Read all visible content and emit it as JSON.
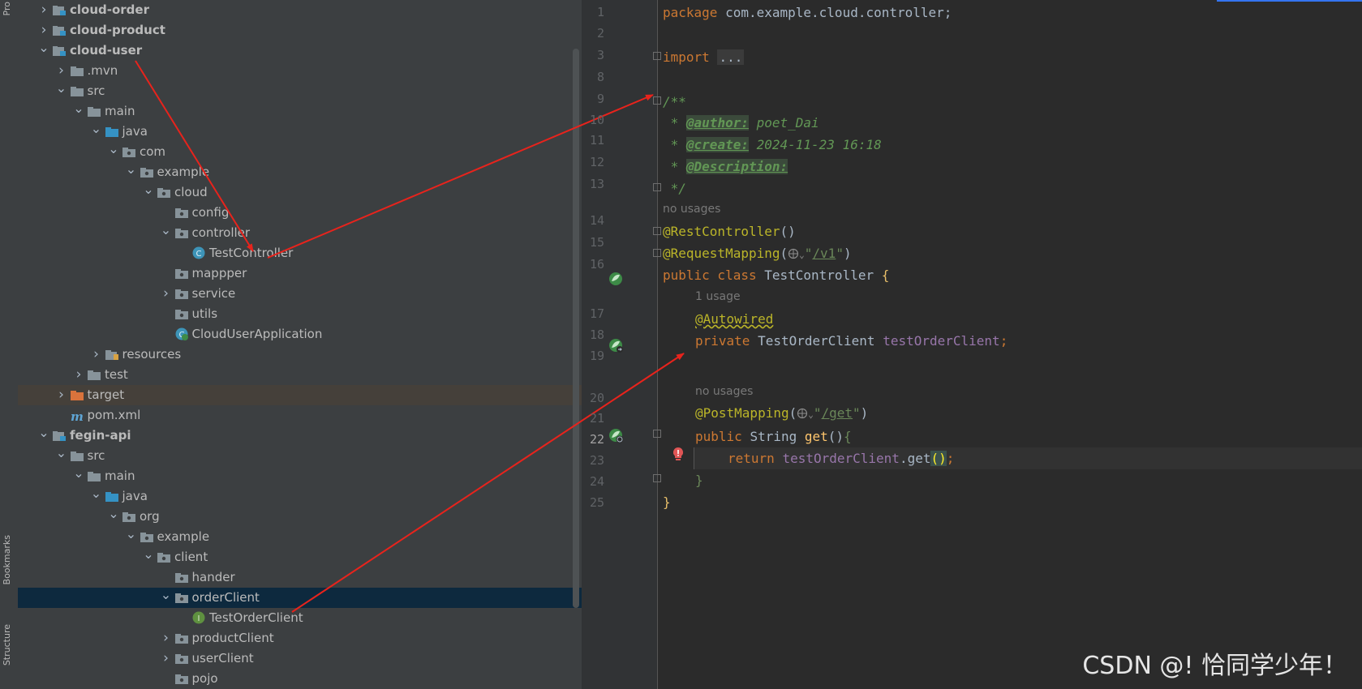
{
  "sidebar": {
    "tabs": [
      "Pro",
      "Bookmarks",
      "Structure"
    ]
  },
  "tree": [
    {
      "label": "cloud-order",
      "depth": 2,
      "arrow": "right",
      "icon": "module",
      "bold": true
    },
    {
      "label": "cloud-product",
      "depth": 2,
      "arrow": "right",
      "icon": "module",
      "bold": true
    },
    {
      "label": "cloud-user",
      "depth": 2,
      "arrow": "down",
      "icon": "module",
      "bold": true
    },
    {
      "label": ".mvn",
      "depth": 3,
      "arrow": "right",
      "icon": "folder"
    },
    {
      "label": "src",
      "depth": 3,
      "arrow": "down",
      "icon": "folder"
    },
    {
      "label": "main",
      "depth": 4,
      "arrow": "down",
      "icon": "folder"
    },
    {
      "label": "java",
      "depth": 5,
      "arrow": "down",
      "icon": "folder-blue"
    },
    {
      "label": "com",
      "depth": 6,
      "arrow": "down",
      "icon": "package"
    },
    {
      "label": "example",
      "depth": 7,
      "arrow": "down",
      "icon": "package"
    },
    {
      "label": "cloud",
      "depth": 8,
      "arrow": "down",
      "icon": "package"
    },
    {
      "label": "config",
      "depth": 9,
      "arrow": "none",
      "icon": "package"
    },
    {
      "label": "controller",
      "depth": 9,
      "arrow": "down",
      "icon": "package"
    },
    {
      "label": "TestController",
      "depth": 10,
      "arrow": "none",
      "icon": "class"
    },
    {
      "label": "mappper",
      "depth": 9,
      "arrow": "none",
      "icon": "package"
    },
    {
      "label": "service",
      "depth": 9,
      "arrow": "right",
      "icon": "package"
    },
    {
      "label": "utils",
      "depth": 9,
      "arrow": "none",
      "icon": "package"
    },
    {
      "label": "CloudUserApplication",
      "depth": 9,
      "arrow": "none",
      "icon": "spring-class"
    },
    {
      "label": "resources",
      "depth": 5,
      "arrow": "right",
      "icon": "resources"
    },
    {
      "label": "test",
      "depth": 4,
      "arrow": "right",
      "icon": "folder"
    },
    {
      "label": "target",
      "depth": 3,
      "arrow": "right",
      "icon": "folder-orange",
      "highlight": true
    },
    {
      "label": "pom.xml",
      "depth": 3,
      "arrow": "none",
      "icon": "maven"
    },
    {
      "label": "fegin-api",
      "depth": 2,
      "arrow": "down",
      "icon": "module",
      "bold": true
    },
    {
      "label": "src",
      "depth": 3,
      "arrow": "down",
      "icon": "folder"
    },
    {
      "label": "main",
      "depth": 4,
      "arrow": "down",
      "icon": "folder"
    },
    {
      "label": "java",
      "depth": 5,
      "arrow": "down",
      "icon": "folder-blue"
    },
    {
      "label": "org",
      "depth": 6,
      "arrow": "down",
      "icon": "package"
    },
    {
      "label": "example",
      "depth": 7,
      "arrow": "down",
      "icon": "package"
    },
    {
      "label": "client",
      "depth": 8,
      "arrow": "down",
      "icon": "package"
    },
    {
      "label": "hander",
      "depth": 9,
      "arrow": "none",
      "icon": "package"
    },
    {
      "label": "orderClient",
      "depth": 9,
      "arrow": "down",
      "icon": "package",
      "selected": true
    },
    {
      "label": "TestOrderClient",
      "depth": 10,
      "arrow": "none",
      "icon": "interface"
    },
    {
      "label": "productClient",
      "depth": 9,
      "arrow": "right",
      "icon": "package"
    },
    {
      "label": "userClient",
      "depth": 9,
      "arrow": "right",
      "icon": "package"
    },
    {
      "label": "pojo",
      "depth": 9,
      "arrow": "none",
      "icon": "package"
    }
  ],
  "editor": {
    "line_numbers": [
      "1",
      "2",
      "3",
      "8",
      "9",
      "10",
      "11",
      "12",
      "13",
      "14",
      "15",
      "16",
      "17",
      "18",
      "19",
      "20",
      "21",
      "22",
      "23",
      "24",
      "25"
    ],
    "current_line": "22",
    "code": {
      "l1_kw": "package",
      "l1_rest": " com.example.cloud.controller;",
      "l3_kw": "import",
      "l3_fold": "...",
      "l9": "/**",
      "l10_star": " * ",
      "l10_tag": "@author:",
      "l10_val": " poet_Dai",
      "l11_star": " * ",
      "l11_tag": "@create:",
      "l11_val": " 2024-11-23 16:18",
      "l12_star": " * ",
      "l12_tag": "@Description:",
      "l13": " */",
      "hint_no_usages_1": "no usages",
      "l14_ann": "@RestController",
      "l14_paren": "()",
      "l15_ann": "@RequestMapping",
      "l15_open": "(",
      "l15_q1": "\"",
      "l15_url": "/v1",
      "l15_q2": "\"",
      "l15_close": ")",
      "l16_kw": "public class ",
      "l16_name": "TestController ",
      "l16_brace": "{",
      "hint_1_usage": "1 usage",
      "l17_ann": "@Autowired",
      "l18_kw": "private ",
      "l18_type": "TestOrderClient ",
      "l18_field": "testOrderClient",
      "l18_semi": ";",
      "hint_no_usages_2": "no usages",
      "l20_ann": "@PostMapping",
      "l20_open": "(",
      "l20_q1": "\"",
      "l20_url": "/get",
      "l20_q2": "\"",
      "l20_close": ")",
      "l21_kw": "public ",
      "l21_type": "String ",
      "l21_method": "get",
      "l21_paren": "()",
      "l21_brace": "{",
      "l22_kw": "return ",
      "l22_field": "testOrderClient",
      "l22_dot": ".get",
      "l22_paren": "()",
      "l22_semi": ";",
      "l23": "}",
      "l24": "}"
    }
  },
  "watermark": "CSDN @! 恰同学少年！",
  "colors": {
    "arrow": "#e8231c",
    "selection": "#0d293e",
    "keyword": "#cc7832",
    "annotation": "#bbb529",
    "string": "#6a8759",
    "field": "#9876aa"
  }
}
